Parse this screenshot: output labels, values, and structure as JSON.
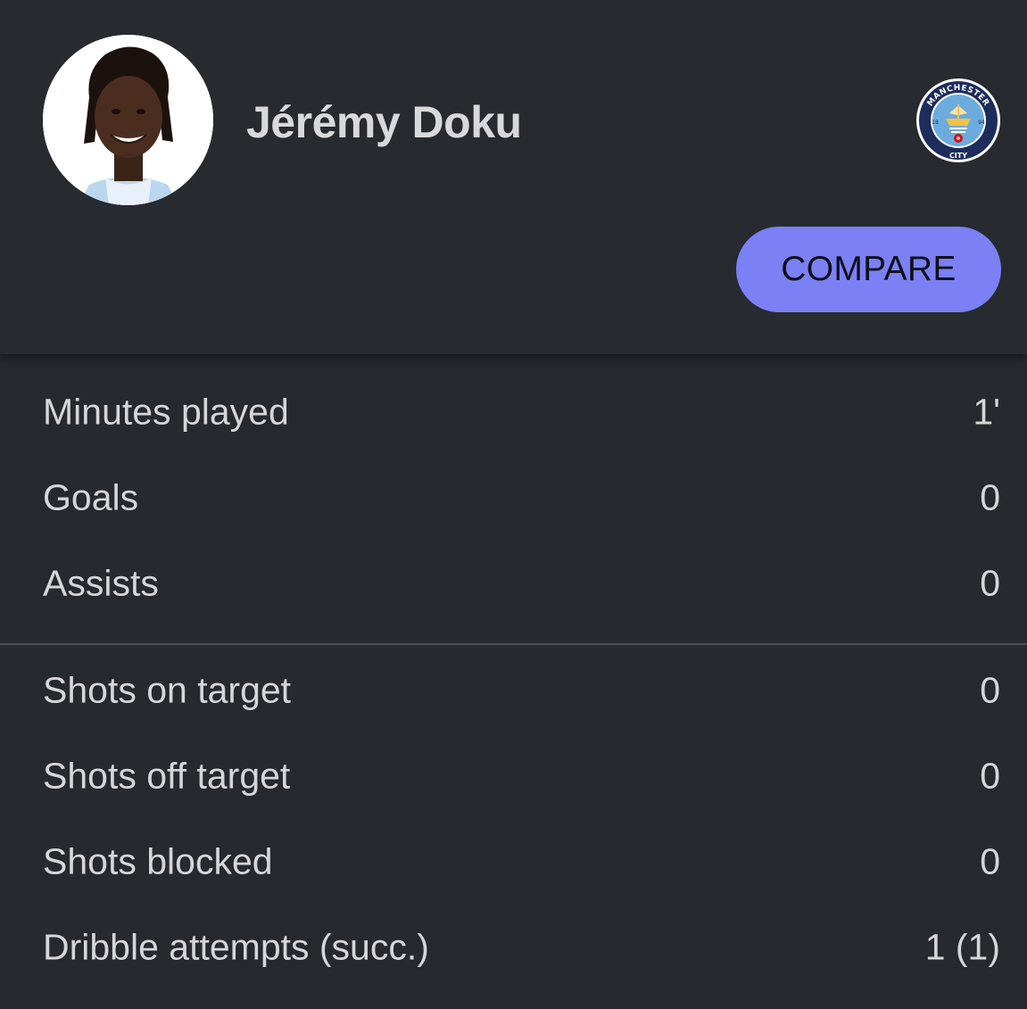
{
  "player": {
    "name": "Jérémy Doku",
    "avatar_icon": "player-photo",
    "club_icon": "manchester-city-crest",
    "club_crest_text_top": "MANCHESTER",
    "club_crest_text_bottom": "CITY",
    "club_crest_year_left": "18",
    "club_crest_year_right": "94"
  },
  "actions": {
    "compare_label": "COMPARE"
  },
  "stats_primary": [
    {
      "label": "Minutes played",
      "value": "1'"
    },
    {
      "label": "Goals",
      "value": "0"
    },
    {
      "label": "Assists",
      "value": "0"
    }
  ],
  "stats_secondary": [
    {
      "label": "Shots on target",
      "value": "0"
    },
    {
      "label": "Shots off target",
      "value": "0"
    },
    {
      "label": "Shots blocked",
      "value": "0"
    },
    {
      "label": "Dribble attempts (succ.)",
      "value": "1 (1)"
    }
  ],
  "colors": {
    "background": "#26292e",
    "accent": "#7b80f4",
    "text": "#d6d6d8",
    "divider": "#4d5056"
  }
}
